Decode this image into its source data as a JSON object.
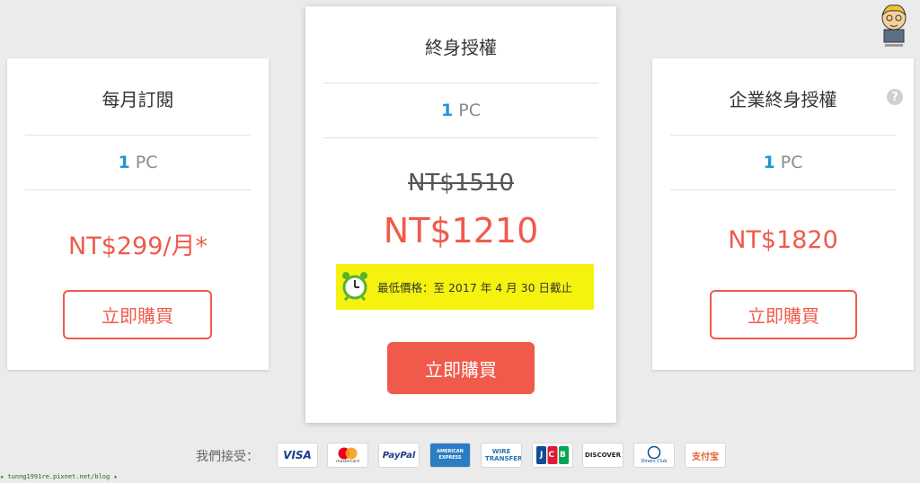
{
  "plans": {
    "monthly": {
      "title": "每月訂閱",
      "pc_count": "1",
      "pc_unit": "PC",
      "price": "NT$299/月*",
      "buy_label": "立即購買"
    },
    "lifetime": {
      "title": "終身授權",
      "pc_count": "1",
      "pc_unit": "PC",
      "old_price": "NT$1510",
      "price": "NT$1210",
      "promo": "最低價格：至 2017 年 4 月 30 日截止",
      "buy_label": "立即購買"
    },
    "enterprise": {
      "title": "企業終身授權",
      "pc_count": "1",
      "pc_unit": "PC",
      "price": "NT$1820",
      "buy_label": "立即購買",
      "help": "?"
    }
  },
  "payments": {
    "label": "我們接受：",
    "methods": [
      "VISA",
      "mastercard",
      "PayPal",
      "AMERICAN EXPRESS",
      "WIRE TRANSFER",
      "JCB",
      "DISCOVER",
      "Diners Club",
      "支付宝"
    ]
  },
  "colors": {
    "accent": "#f05a4b",
    "pc_count": "#2196d3",
    "promo_bg": "#f5f20f"
  },
  "watermark": "★ tunng1991re.pixnet.net/blog ★"
}
